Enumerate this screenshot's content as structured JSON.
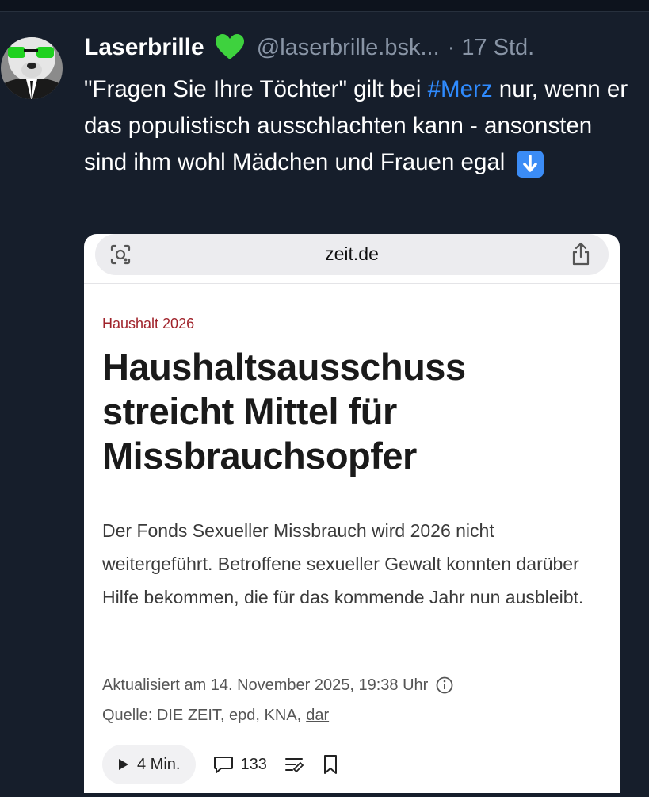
{
  "post": {
    "author_name": "Laserbrille",
    "handle": "@laserbrille.bsk...",
    "separator": "·",
    "time": "17 Std.",
    "text_before": "\"Fragen Sie Ihre Töchter\" gilt bei ",
    "hashtag": "#Merz",
    "text_after": " nur, wenn er das populistisch ausschlachten kann - ansonsten sind ihm wohl Mädchen und Frauen egal",
    "heart_color": "#3ed23e",
    "hashtag_color": "#2f8bff"
  },
  "browser": {
    "url": "zeit.de"
  },
  "article": {
    "kicker": "Haushalt 2026",
    "headline": "Haushaltsausschuss streicht Mittel für Missbrauchsopfer",
    "summary": "Der Fonds Sexueller Missbrauch wird 2026 nicht weitergeführt. Betroffene sexueller Gewalt konnten darüber Hilfe bekommen, die für das kommende Jahr nun ausbleibt.",
    "updated": "Aktualisiert am 14. November 2025, 19:38 Uhr",
    "source_prefix": "Quelle: DIE ZEIT, epd, KNA,",
    "author": "dar",
    "read_time": "4 Min.",
    "comment_count": "133",
    "kicker_color": "#a0232b"
  },
  "icons": {
    "avatar": "dog-with-sunglasses-avatar",
    "heart_emoji": "green-heart-icon",
    "arrow_emoji": "down-arrow-icon",
    "camera": "camera-icon",
    "share": "share-icon",
    "info": "info-icon",
    "play": "play-icon",
    "comment": "comment-icon",
    "list": "list-icon",
    "bookmark": "bookmark-icon",
    "like": "like-heart-icon",
    "reply": "reply-bubble-icon",
    "repost": "repost-icon"
  }
}
